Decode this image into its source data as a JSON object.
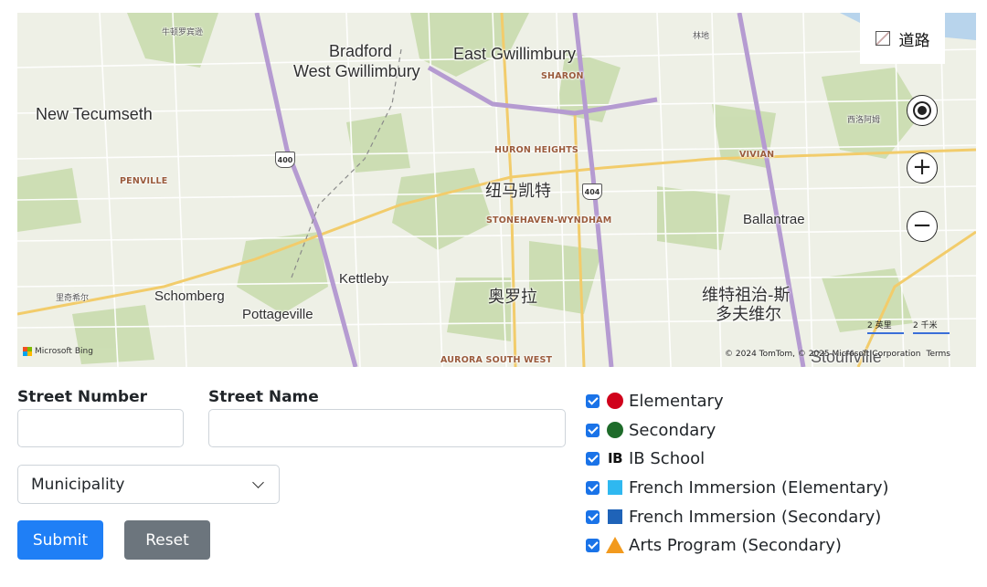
{
  "map": {
    "style_toggle_label": "道路",
    "labels": {
      "niudun": "牛顿罗宾逊",
      "bradford": "Bradford",
      "west_gwillimbury": "West Gwillimbury",
      "east_gwillimbury": "East Gwillimbury",
      "sharon": "SHARON",
      "linxin": "林地",
      "new_tecumseth": "New Tecumseth",
      "xiluoa": "西洛阿姆",
      "huron_heights": "HURON HEIGHTS",
      "vivian": "VIVIAN",
      "penville": "PENVILLE",
      "newmarket": "纽马凯特",
      "stonehaven": "STONEHAVEN-WYNDHAM",
      "ballantrae": "Ballantrae",
      "kettleby": "Kettleby",
      "liqixier": "里奇希尔",
      "schomberg": "Schomberg",
      "pottageville": "Pottageville",
      "aurora": "奥罗拉",
      "stouffville_cn_1": "维特祖治-斯",
      "stouffville_cn_2": "多夫维尔",
      "aurora_south_west": "AURORA SOUTH WEST",
      "stouffville": "Stouffville"
    },
    "highways": {
      "h400": "400",
      "h404": "404"
    },
    "scale": {
      "imperial": "2 英里",
      "metric": "2 千米"
    },
    "attribution": "© 2024 TomTom, © 2025 Microsoft Corporation",
    "terms_label": "Terms",
    "bing_label": "Microsoft Bing",
    "controls": {
      "locate_icon": "locate-icon",
      "zoom_in_glyph": "+",
      "zoom_out_glyph": "−"
    }
  },
  "form": {
    "street_number_label": "Street Number",
    "street_number_value": "",
    "street_name_label": "Street Name",
    "street_name_value": "",
    "municipality_selected": "Municipality",
    "submit_label": "Submit",
    "reset_label": "Reset"
  },
  "legend": [
    {
      "label": "Elementary",
      "checked": true,
      "marker": "red-circle",
      "color": "#d0021b"
    },
    {
      "label": "Secondary",
      "checked": true,
      "marker": "green-circle",
      "color": "#1e6b2a"
    },
    {
      "label": "IB School",
      "checked": true,
      "marker": "ib-text",
      "marker_text": "IB"
    },
    {
      "label": "French Immersion (Elementary)",
      "checked": true,
      "marker": "light-blue-square",
      "color": "#2fb8f0"
    },
    {
      "label": "French Immersion (Secondary)",
      "checked": true,
      "marker": "blue-square",
      "color": "#1f63b8"
    },
    {
      "label": "Arts Program (Secondary)",
      "checked": true,
      "marker": "orange-triangle",
      "color": "#f29a1e"
    }
  ]
}
